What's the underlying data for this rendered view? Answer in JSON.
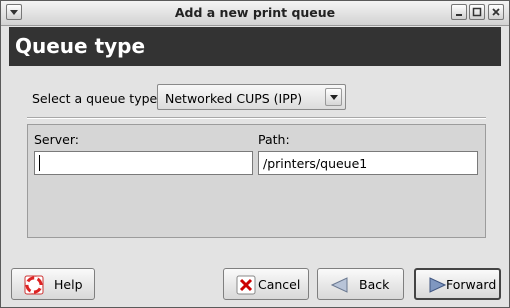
{
  "window": {
    "title": "Add a new print queue"
  },
  "banner": {
    "title": "Queue type"
  },
  "queue_type": {
    "label": "Select a queue type:",
    "selected": "Networked CUPS (IPP)"
  },
  "fields": {
    "server_label": "Server:",
    "server_value": "",
    "path_label": "Path:",
    "path_value": "/printers/queue1"
  },
  "buttons": {
    "help": "Help",
    "cancel": "Cancel",
    "back": "Back",
    "forward": "Forward"
  },
  "colors": {
    "banner_bg": "#333333",
    "window_bg": "#e3e3e3",
    "panel_bg": "#d6d6d6"
  }
}
